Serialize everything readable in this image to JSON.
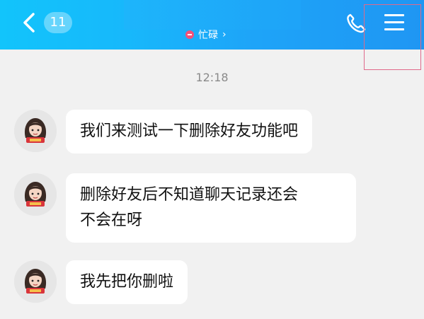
{
  "header": {
    "back_icon": "chevron-left-icon",
    "unread_count": "11",
    "status_icon": "busy-minus-icon",
    "status_text": "忙碌",
    "status_chevron": "›",
    "phone_icon": "phone-icon",
    "menu_icon": "hamburger-menu-icon",
    "highlight_color": "#e0698a",
    "bg_colors": [
      "#12c4fb",
      "#1f96f3"
    ]
  },
  "chat": {
    "timestamp": "12:18",
    "messages": [
      {
        "avatar": "avatar-girl-icon",
        "lines": [
          "我们来测试一下删除好友功能吧"
        ]
      },
      {
        "avatar": "avatar-girl-icon",
        "lines": [
          "删除好友后不知道聊天记录还会",
          "不会在呀"
        ]
      },
      {
        "avatar": "avatar-girl-icon",
        "lines": [
          "我先把你删啦"
        ]
      }
    ]
  }
}
